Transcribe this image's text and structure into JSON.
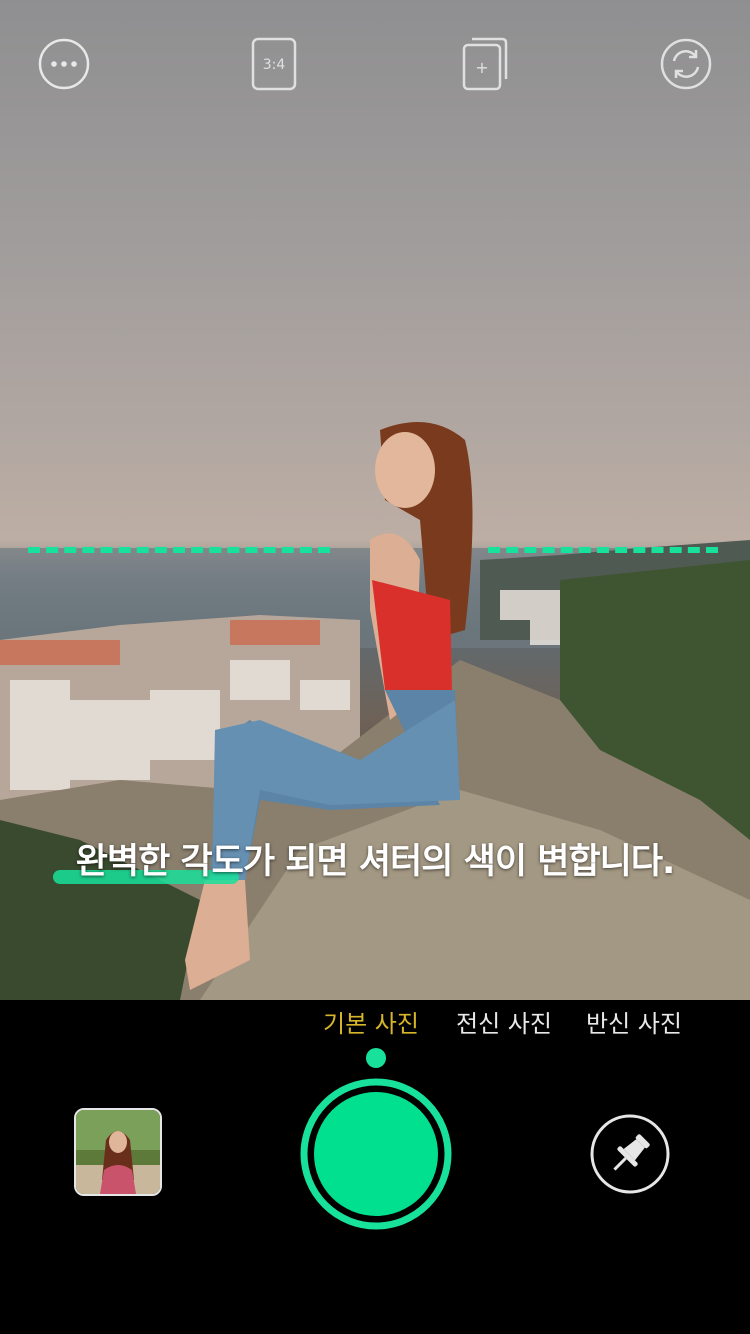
{
  "topbar": {
    "more_icon": "ellipsis-circle-icon",
    "ratio_label": "3:4",
    "add_frame_label": "+",
    "rotate_icon": "camera-flip-icon"
  },
  "overlay": {
    "caption": "완벽한 각도가 되면 셔터의 색이 변합니다.",
    "guide_color": "#17e19a"
  },
  "modes": [
    {
      "label": "기본 사진",
      "active": true
    },
    {
      "label": "전신 사진",
      "active": false
    },
    {
      "label": "반신 사진",
      "active": false
    }
  ],
  "controls": {
    "shutter_color": "#00e08f",
    "thumbnail_icon": "gallery-thumbnail",
    "pin_icon": "pushpin-icon"
  },
  "colors": {
    "accent": "#17e19a",
    "active_mode": "#d7b52a",
    "background": "#000000"
  }
}
